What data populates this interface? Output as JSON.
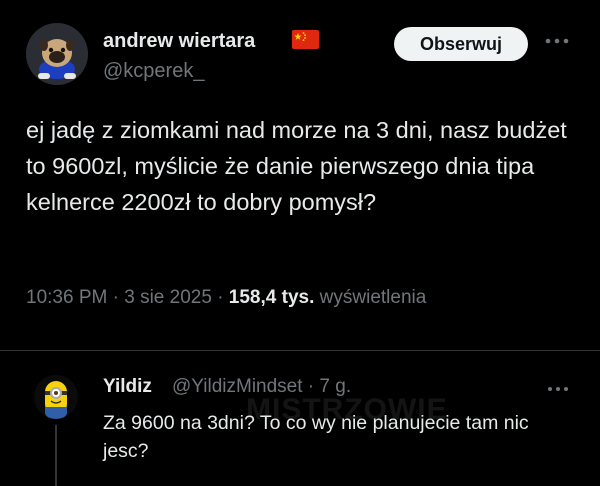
{
  "tweet": {
    "author_name": "andrew wiertara",
    "author_handle": "@kcperek_",
    "follow_label": "Obserwuj",
    "text": "ej jadę z ziomkami nad morze na 3 dni, nasz budżet to 9600zl, myślicie że danie pierwszego dnia tipa kelnerce 2200zł to dobry pomysł?",
    "time": "10:36 PM",
    "date": "3 sie 2025",
    "views_count": "158,4 tys.",
    "views_label": "wyświetlenia",
    "flag_icon": "china-flag-icon"
  },
  "reply": {
    "author_name": "Yildiz",
    "author_handle": "@YildizMindset",
    "separator": "·",
    "age": "7 g.",
    "text": "Za 9600 na 3dni? To co wy nie planujecie tam nic jesc?"
  },
  "watermark": "MISTRZOWIE",
  "colors": {
    "background": "#000000",
    "text": "#e7e9ea",
    "muted": "#71767b",
    "divider": "#2f3336",
    "button_bg": "#eff3f4"
  }
}
